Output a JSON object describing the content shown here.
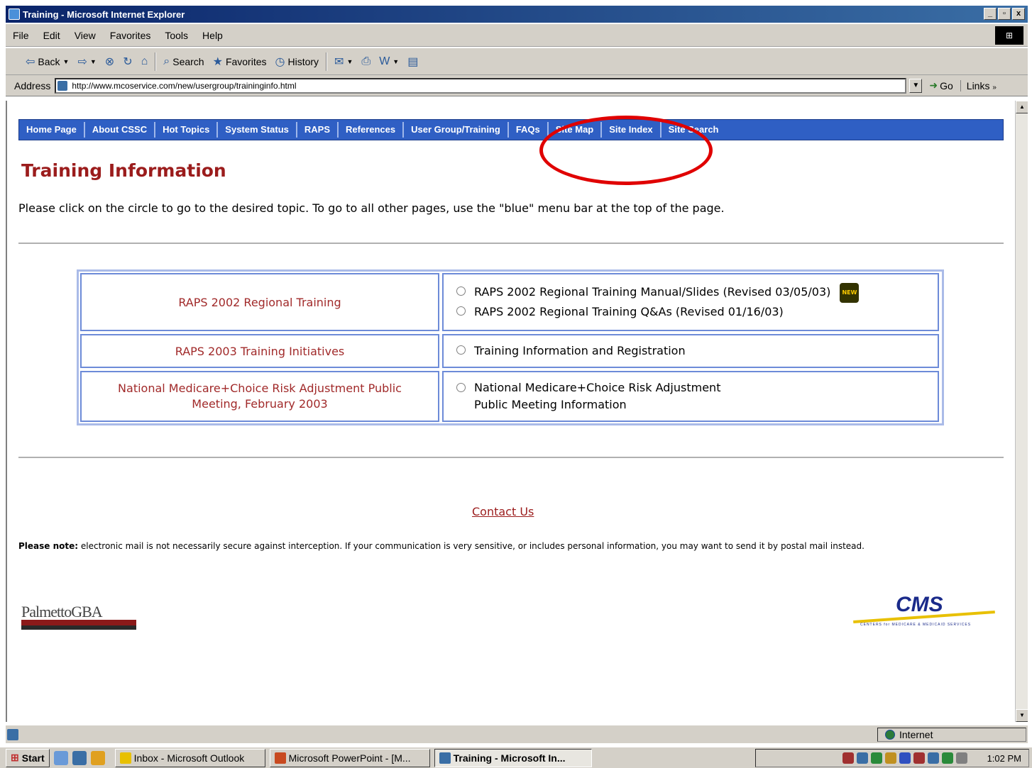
{
  "window": {
    "title": "Training - Microsoft Internet Explorer",
    "min": "_",
    "max": "▫",
    "close": "x"
  },
  "menu": [
    "File",
    "Edit",
    "View",
    "Favorites",
    "Tools",
    "Help"
  ],
  "toolbar": {
    "back": "Back",
    "search": "Search",
    "favorites": "Favorites",
    "history": "History"
  },
  "address": {
    "label": "Address",
    "url": "http://www.mcoservice.com/new/usergroup/traininginfo.html",
    "go": "Go",
    "links": "Links"
  },
  "nav": [
    "Home Page",
    "About CSSC",
    "Hot Topics",
    "System Status",
    "RAPS",
    "References",
    "User Group/Training",
    "FAQs",
    "Site Map",
    "Site Index",
    "Site Search"
  ],
  "page": {
    "title": "Training Information",
    "intro": "Please click on the circle to go to the desired topic. To go to all other pages, use the \"blue\" menu bar at the top of the page.",
    "rows": [
      {
        "topic": "RAPS 2002 Regional Training",
        "options": [
          "RAPS 2002 Regional Training Manual/Slides (Revised 03/05/03)",
          "RAPS 2002 Regional Training Q&As (Revised 01/16/03)"
        ],
        "badge": "NEW"
      },
      {
        "topic": "RAPS 2003 Training Initiatives",
        "options": [
          "Training Information and Registration"
        ]
      },
      {
        "topic_line1": "National Medicare+Choice Risk Adjustment Public",
        "topic_line2": "Meeting, February 2003",
        "option_line1": "National Medicare+Choice Risk Adjustment",
        "option_line2": "Public Meeting Information"
      }
    ],
    "contact": "Contact Us",
    "note_label": "Please note:",
    "note_text": " electronic mail is not necessarily secure against interception. If your communication is very sensitive, or includes personal information, you may want to send it by postal mail instead.",
    "logo_left": "PalmettoGBA",
    "logo_right": "CMS",
    "logo_right_sub": "CENTERS for MEDICARE & MEDICAID SERVICES"
  },
  "status": {
    "zone": "Internet"
  },
  "taskbar": {
    "start": "Start",
    "tasks": [
      "Inbox - Microsoft Outlook",
      "Microsoft PowerPoint - [M...",
      "Training - Microsoft In..."
    ],
    "clock": "1:02 PM"
  },
  "colors": {
    "nav_bg": "#2f5fc4",
    "title_red": "#9b1c1c",
    "highlight_ring": "#e00000"
  }
}
